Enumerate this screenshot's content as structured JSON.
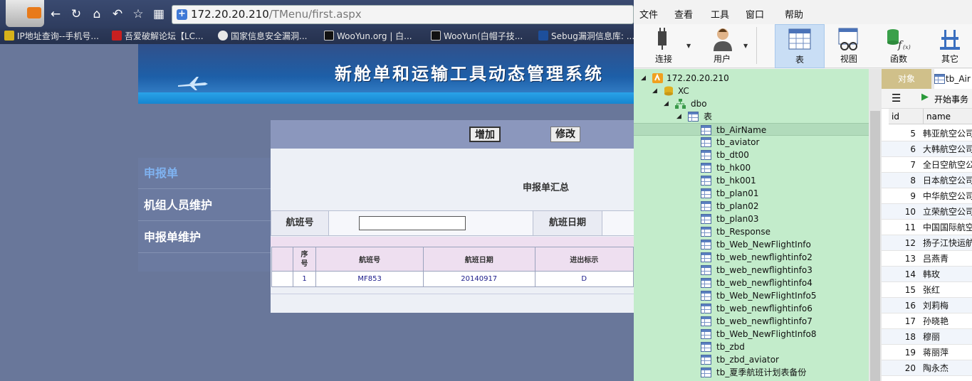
{
  "browser": {
    "url_host": "172.20.20.210",
    "url_path": "/TMenu/first.aspx",
    "bookmarks": [
      "IP地址查询--手机号...",
      "吾爱破解论坛【LC...",
      "国家信息安全漏洞...",
      "WooYun.org | 白...",
      "WooYun(白帽子技...",
      "Sebug漏洞信息库: ..."
    ]
  },
  "webapp": {
    "title": "新舱单和运输工具动态管理系统",
    "sidebar": [
      "申报单",
      "机组人员维护",
      "申报单维护"
    ],
    "buttons": {
      "add": "增加",
      "edit": "修改"
    },
    "summary_title": "申报单汇总",
    "search_labels": {
      "flight_no": "航班号",
      "flight_date": "航班日期"
    },
    "table": {
      "headers": {
        "seq": "序\n号",
        "flight_no": "航班号",
        "flight_date": "航班日期",
        "inout": "进出标示"
      },
      "rows": [
        {
          "seq": "1",
          "flight_no": "MF853",
          "flight_date": "20140917",
          "inout": "D"
        }
      ]
    }
  },
  "dbtool": {
    "menu": [
      "文件",
      "查看",
      "工具",
      "窗口",
      "帮助"
    ],
    "ribbon": {
      "connect": "连接",
      "user": "用户",
      "table": "表",
      "view": "视图",
      "function": "函数",
      "other": "其它"
    },
    "tree": {
      "server": "172.20.20.210",
      "database": "XC",
      "schema": "dbo",
      "tables_folder": "表",
      "tables": [
        "tb_AirName",
        "tb_aviator",
        "tb_dt00",
        "tb_hk00",
        "tb_hk001",
        "tb_plan01",
        "tb_plan02",
        "tb_plan03",
        "tb_Response",
        "tb_Web_NewFlightInfo",
        "tb_web_newflightinfo2",
        "tb_web_newflightinfo3",
        "tb_web_newflightinfo4",
        "tb_Web_NewFlightInfo5",
        "tb_web_newflightinfo6",
        "tb_web_newflightinfo7",
        "tb_Web_NewFlightInfo8",
        "tb_zbd",
        "tb_zbd_aviator",
        "tb_夏季航班计划表备份"
      ]
    },
    "tabs": {
      "objects": "对象",
      "open_table": "tb_Air"
    },
    "toolbar": {
      "begin_transaction": "开始事务"
    },
    "grid": {
      "headers": {
        "id": "id",
        "name": "name"
      },
      "rows": [
        {
          "id": "5",
          "name": "韩亚航空公司"
        },
        {
          "id": "6",
          "name": "大韩航空公司"
        },
        {
          "id": "7",
          "name": "全日空航空公"
        },
        {
          "id": "8",
          "name": "日本航空公司"
        },
        {
          "id": "9",
          "name": "中华航空公司"
        },
        {
          "id": "10",
          "name": "立荣航空公司"
        },
        {
          "id": "11",
          "name": "中国国际航空"
        },
        {
          "id": "12",
          "name": "扬子江快运航"
        },
        {
          "id": "13",
          "name": "吕燕青"
        },
        {
          "id": "14",
          "name": "韩玫"
        },
        {
          "id": "15",
          "name": "张红"
        },
        {
          "id": "16",
          "name": "刘莉梅"
        },
        {
          "id": "17",
          "name": "孙晓艳"
        },
        {
          "id": "18",
          "name": "穆丽"
        },
        {
          "id": "19",
          "name": "蒋丽萍"
        },
        {
          "id": "20",
          "name": "陶永杰"
        }
      ]
    }
  }
}
